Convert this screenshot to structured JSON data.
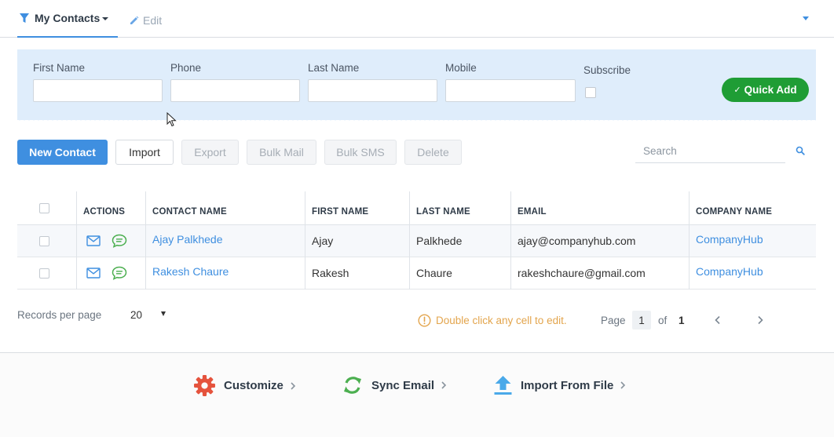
{
  "header": {
    "view_label": "My Contacts",
    "edit_label": "Edit"
  },
  "quick_add": {
    "first_name_label": "First Name",
    "phone_label": "Phone",
    "last_name_label": "Last Name",
    "mobile_label": "Mobile",
    "subscribe_label": "Subscribe",
    "button_label": "Quick Add",
    "subscribe_checked": false
  },
  "toolbar": {
    "new_contact": "New Contact",
    "import": "Import",
    "export": "Export",
    "bulk_mail": "Bulk Mail",
    "bulk_sms": "Bulk SMS",
    "delete": "Delete",
    "search_placeholder": "Search"
  },
  "table": {
    "columns": [
      "ACTIONS",
      "CONTACT NAME",
      "FIRST NAME",
      "LAST NAME",
      "EMAIL",
      "COMPANY NAME"
    ],
    "rows": [
      {
        "contact_name": "Ajay Palkhede",
        "first_name": "Ajay",
        "last_name": "Palkhede",
        "email": "ajay@companyhub.com",
        "company": "CompanyHub"
      },
      {
        "contact_name": "Rakesh Chaure",
        "first_name": "Rakesh",
        "last_name": "Chaure",
        "email": "rakeshchaure@gmail.com",
        "company": "CompanyHub"
      }
    ]
  },
  "pager": {
    "records_label": "Records per page",
    "records_value": "20",
    "hint": "Double click any cell to edit.",
    "page_label": "Page",
    "current_page": "1",
    "of_label": "of",
    "total_pages": "1"
  },
  "footer": {
    "customize": "Customize",
    "sync_email": "Sync Email",
    "import_file": "Import From File"
  },
  "colors": {
    "accent": "#3f8fe0",
    "success": "#1f9d35",
    "warning": "#e3a54d",
    "gear": "#e5533d",
    "sync": "#4caf50"
  }
}
